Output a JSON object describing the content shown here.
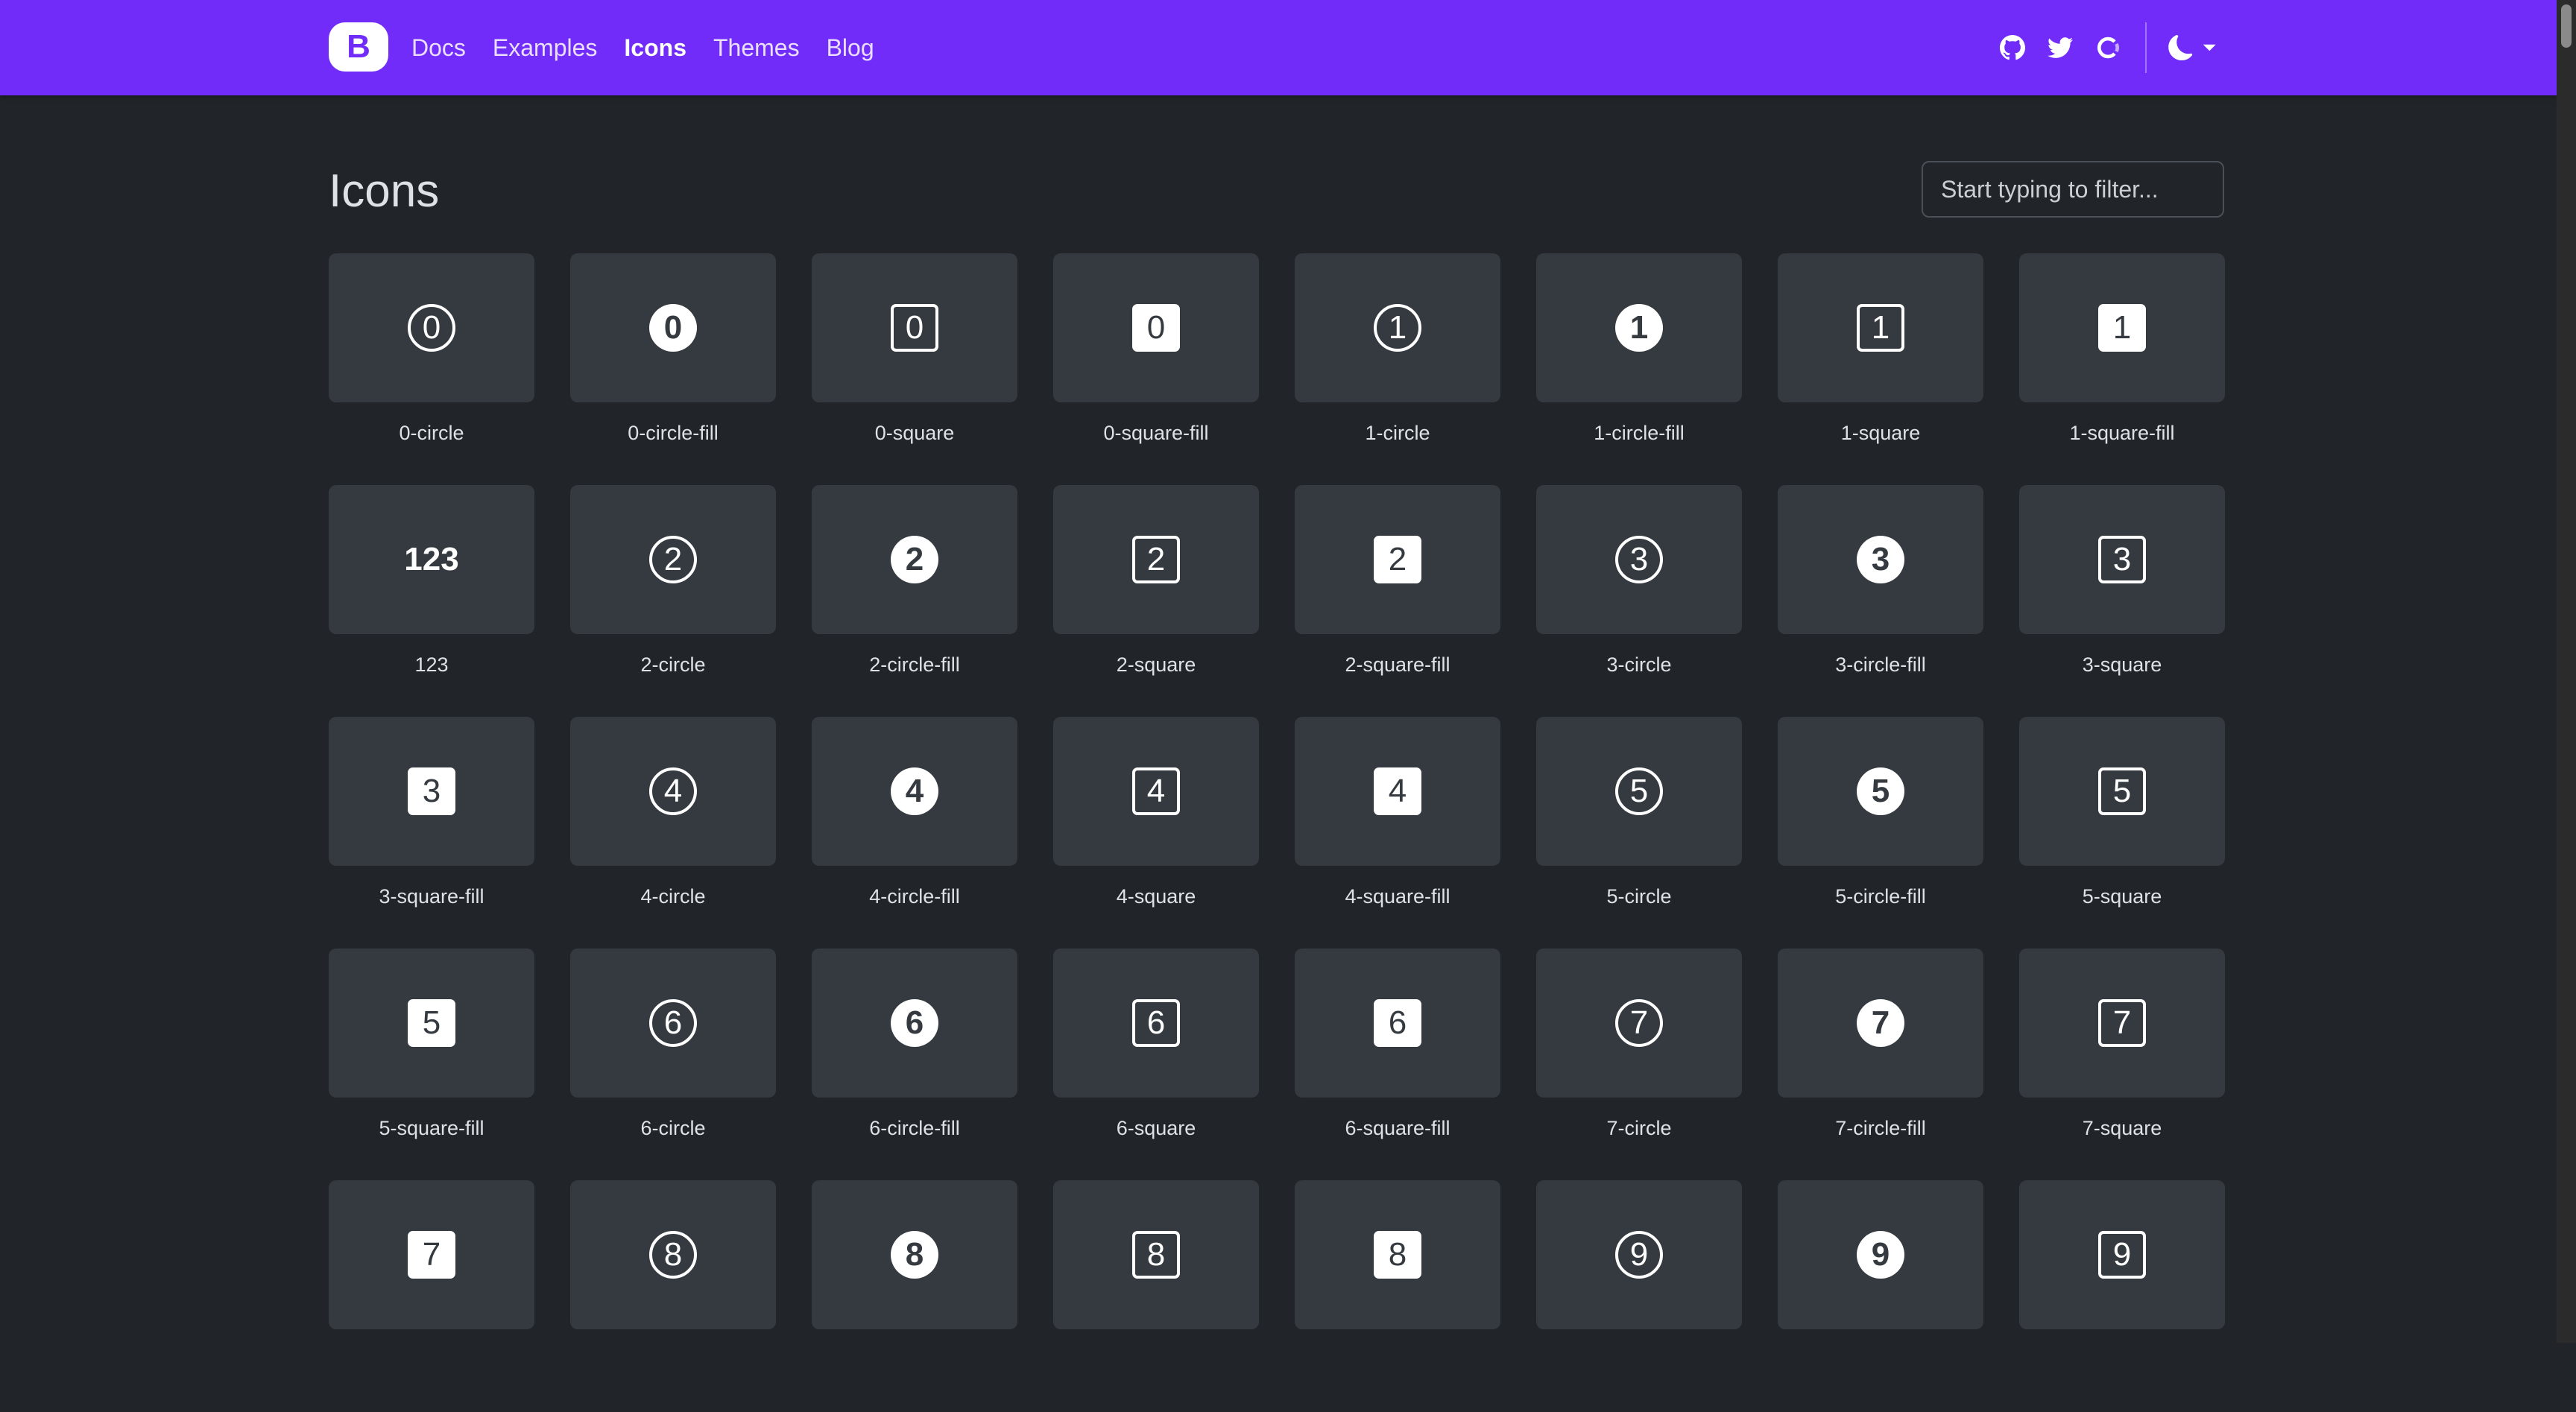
{
  "navbar": {
    "brand": "B",
    "links": [
      {
        "label": "Docs",
        "active": false
      },
      {
        "label": "Examples",
        "active": false
      },
      {
        "label": "Icons",
        "active": true
      },
      {
        "label": "Themes",
        "active": false
      },
      {
        "label": "Blog",
        "active": false
      }
    ],
    "icons": [
      "github-icon",
      "twitter-icon",
      "opencollective-icon",
      "theme-toggle-icon"
    ]
  },
  "page": {
    "title": "Icons",
    "filter_placeholder": "Start typing to filter..."
  },
  "colors": {
    "brand": "#712cf9",
    "background": "#212529",
    "tile": "#343a40",
    "text": "#dee2e6"
  },
  "icons": [
    {
      "label": "0-circle",
      "glyph": "0",
      "style": "circle"
    },
    {
      "label": "0-circle-fill",
      "glyph": "0",
      "style": "circle-fill"
    },
    {
      "label": "0-square",
      "glyph": "0",
      "style": "square"
    },
    {
      "label": "0-square-fill",
      "glyph": "0",
      "style": "square-fill"
    },
    {
      "label": "1-circle",
      "glyph": "1",
      "style": "circle"
    },
    {
      "label": "1-circle-fill",
      "glyph": "1",
      "style": "circle-fill"
    },
    {
      "label": "1-square",
      "glyph": "1",
      "style": "square"
    },
    {
      "label": "1-square-fill",
      "glyph": "1",
      "style": "square-fill"
    },
    {
      "label": "123",
      "glyph": "123",
      "style": "text"
    },
    {
      "label": "2-circle",
      "glyph": "2",
      "style": "circle"
    },
    {
      "label": "2-circle-fill",
      "glyph": "2",
      "style": "circle-fill"
    },
    {
      "label": "2-square",
      "glyph": "2",
      "style": "square"
    },
    {
      "label": "2-square-fill",
      "glyph": "2",
      "style": "square-fill"
    },
    {
      "label": "3-circle",
      "glyph": "3",
      "style": "circle"
    },
    {
      "label": "3-circle-fill",
      "glyph": "3",
      "style": "circle-fill"
    },
    {
      "label": "3-square",
      "glyph": "3",
      "style": "square"
    },
    {
      "label": "3-square-fill",
      "glyph": "3",
      "style": "square-fill"
    },
    {
      "label": "4-circle",
      "glyph": "4",
      "style": "circle"
    },
    {
      "label": "4-circle-fill",
      "glyph": "4",
      "style": "circle-fill"
    },
    {
      "label": "4-square",
      "glyph": "4",
      "style": "square"
    },
    {
      "label": "4-square-fill",
      "glyph": "4",
      "style": "square-fill"
    },
    {
      "label": "5-circle",
      "glyph": "5",
      "style": "circle"
    },
    {
      "label": "5-circle-fill",
      "glyph": "5",
      "style": "circle-fill"
    },
    {
      "label": "5-square",
      "glyph": "5",
      "style": "square"
    },
    {
      "label": "5-square-fill",
      "glyph": "5",
      "style": "square-fill"
    },
    {
      "label": "6-circle",
      "glyph": "6",
      "style": "circle"
    },
    {
      "label": "6-circle-fill",
      "glyph": "6",
      "style": "circle-fill"
    },
    {
      "label": "6-square",
      "glyph": "6",
      "style": "square"
    },
    {
      "label": "6-square-fill",
      "glyph": "6",
      "style": "square-fill"
    },
    {
      "label": "7-circle",
      "glyph": "7",
      "style": "circle"
    },
    {
      "label": "7-circle-fill",
      "glyph": "7",
      "style": "circle-fill"
    },
    {
      "label": "7-square",
      "glyph": "7",
      "style": "square"
    },
    {
      "label": "",
      "glyph": "7",
      "style": "square-fill"
    },
    {
      "label": "",
      "glyph": "8",
      "style": "circle"
    },
    {
      "label": "",
      "glyph": "8",
      "style": "circle-fill"
    },
    {
      "label": "",
      "glyph": "8",
      "style": "square"
    },
    {
      "label": "",
      "glyph": "8",
      "style": "square-fill"
    },
    {
      "label": "",
      "glyph": "9",
      "style": "circle"
    },
    {
      "label": "",
      "glyph": "9",
      "style": "circle-fill"
    },
    {
      "label": "",
      "glyph": "9",
      "style": "square"
    }
  ]
}
